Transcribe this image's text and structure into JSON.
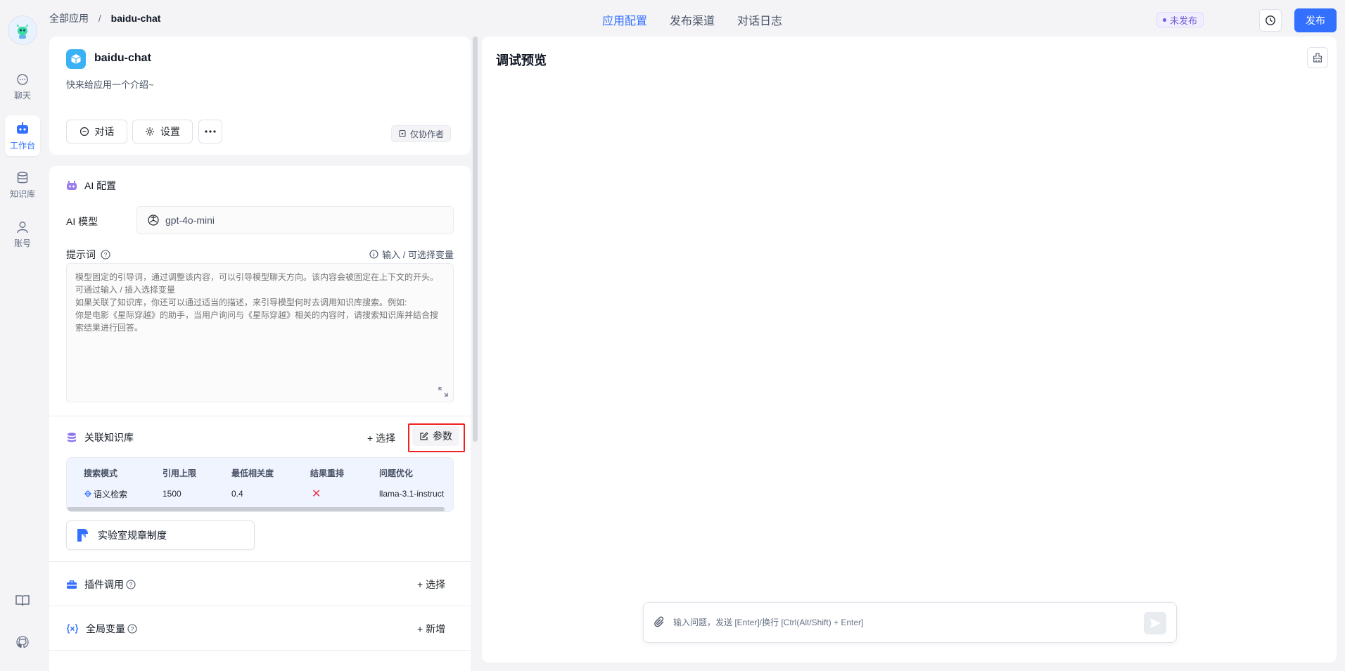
{
  "breadcrumb": {
    "root": "全部应用",
    "separator": "/",
    "current": "baidu-chat"
  },
  "top_tabs": [
    "应用配置",
    "发布渠道",
    "对话日志"
  ],
  "header": {
    "status": "未发布",
    "publish": "发布"
  },
  "left_nav": [
    "聊天",
    "工作台",
    "知识库",
    "账号"
  ],
  "app": {
    "name": "baidu-chat",
    "intro": "快来给应用一个介绍~",
    "chat_btn": "对话",
    "settings_btn": "设置",
    "collab": "仅协作者"
  },
  "ai_config": {
    "title": "AI 配置",
    "model_label": "AI 模型",
    "model_value": "gpt-4o-mini",
    "prompt_label": "提示词",
    "var_hint": "输入 / 可选择变量",
    "prompt_placeholder": "模型固定的引导词，通过调整该内容，可以引导模型聊天方向。该内容会被固定在上下文的开头。可通过输入 / 插入选择变量\n如果关联了知识库，你还可以通过适当的描述，来引导模型何时去调用知识库搜索。例如:\n你是电影《星际穿越》的助手，当用户询问与《星际穿越》相关的内容时，请搜索知识库并结合搜索结果进行回答。"
  },
  "knowledge": {
    "title": "关联知识库",
    "select": "+ 选择",
    "params": "参数",
    "headers": [
      "搜索模式",
      "引用上限",
      "最低相关度",
      "结果重排",
      "问题优化"
    ],
    "row": [
      "语义检索",
      "1500",
      "0.4",
      "✕",
      "llama-3.1-instruct"
    ],
    "item": "实验室规章制度"
  },
  "plugins": {
    "title": "插件调用",
    "select": "+ 选择"
  },
  "variables": {
    "title": "全局变量",
    "add": "+ 新增"
  },
  "debug": {
    "title": "调试预览",
    "placeholder": "输入问题，发送 [Enter]/换行 [Ctrl(Alt/Shift) + Enter]"
  },
  "colors": {
    "accent": "#3370ff",
    "badge": "#6f5dd7",
    "error": "#e8344a"
  }
}
